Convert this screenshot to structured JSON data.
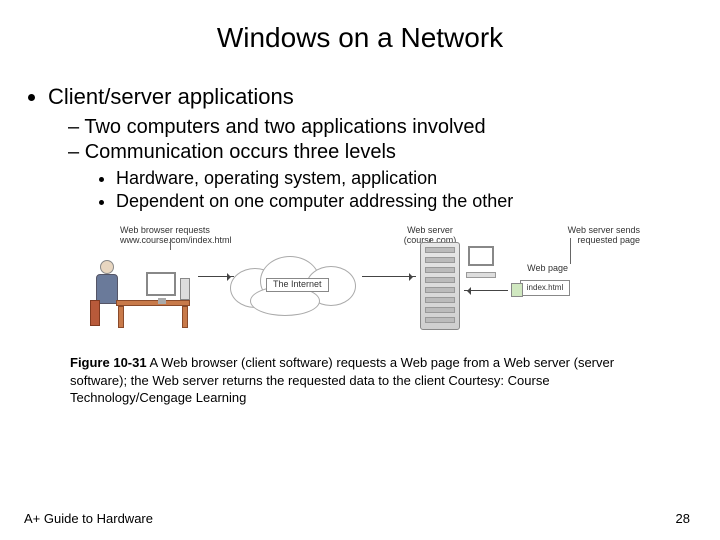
{
  "title": "Windows on a Network",
  "bullets": {
    "l1": "Client/server applications",
    "l2a": "Two computers and two applications involved",
    "l2b": "Communication occurs three levels",
    "l3a": "Hardware, operating system, application",
    "l3b": "Dependent on one computer addressing the other"
  },
  "figure": {
    "browser_label": "Web browser requests www.course.com/index.html",
    "internet_label": "The Internet",
    "webserver_label": "Web server (course.com)",
    "sends_label": "Web server sends requested page",
    "webpage_label": "Web page",
    "file_label": "index.html"
  },
  "caption": {
    "fignum": "Figure 10-31",
    "text": " A Web browser (client software) requests a Web page from a Web server (server software); the Web server returns the requested data to the client Courtesy: Course Technology/Cengage Learning"
  },
  "footer": {
    "left": "A+ Guide to Hardware",
    "page": "28"
  }
}
